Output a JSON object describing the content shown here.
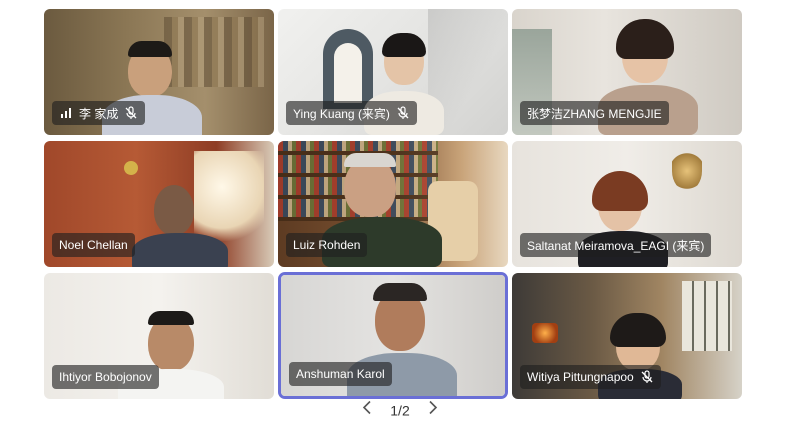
{
  "participants": [
    {
      "name": "李 家成",
      "signal": true,
      "muted": true
    },
    {
      "name": "Ying Kuang (来宾)",
      "signal": false,
      "muted": true
    },
    {
      "name": "张梦洁ZHANG MENGJIE",
      "signal": false,
      "muted": false
    },
    {
      "name": "Noel Chellan",
      "signal": false,
      "muted": false
    },
    {
      "name": "Luiz Rohden",
      "signal": false,
      "muted": false
    },
    {
      "name": "Saltanat Meiramova_EAGI (来宾)",
      "signal": false,
      "muted": false
    },
    {
      "name": "Ihtiyor Bobojonov",
      "signal": false,
      "muted": false
    },
    {
      "name": "Anshuman Karol",
      "signal": false,
      "muted": false,
      "active_speaker": true
    },
    {
      "name": "Witiya Pittungnapoo",
      "signal": false,
      "muted": true
    }
  ],
  "pagination": {
    "label": "1/2",
    "prev": "chevron-left-icon",
    "next": "chevron-right-icon"
  },
  "colors": {
    "active_border": "#6a6fd6",
    "nameplate_bg": "rgba(30,30,30,0.62)"
  }
}
